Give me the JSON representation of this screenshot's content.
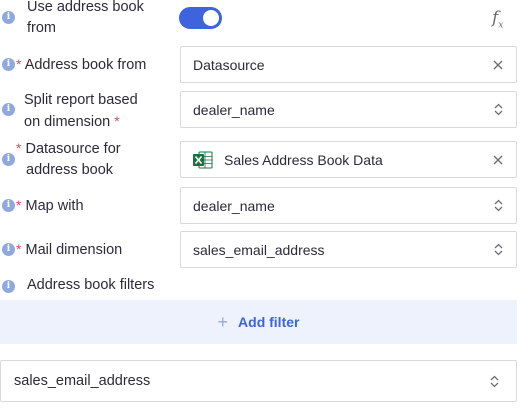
{
  "use_address_book": {
    "label_line1": "Use address book",
    "label_line2": "from",
    "enabled": true,
    "formula_icon": "fx-icon"
  },
  "address_book_from": {
    "label": "Address book from",
    "required_mark": "*",
    "value": "Datasource"
  },
  "split_report": {
    "label_line1": "Split report based",
    "label_line2": "on dimension",
    "required_mark": "*",
    "value": "dealer_name"
  },
  "datasource_for": {
    "label_line1": "Datasource for",
    "label_line2": "address book",
    "required_mark": "*",
    "value": "Sales Address Book Data",
    "icon": "excel-icon"
  },
  "map_with": {
    "label": "Map with",
    "required_mark": "*",
    "value": "dealer_name"
  },
  "mail_dimension": {
    "label": "Mail dimension",
    "required_mark": "*",
    "value": "sales_email_address"
  },
  "address_book_filters": {
    "label": "Address book filters",
    "add_filter_label": "Add filter"
  },
  "bottom_select": {
    "value": "sales_email_address"
  },
  "colors": {
    "accent": "#3d63dd",
    "required": "#e0455b",
    "info": "#8fa9df",
    "filter_bg": "#eef2fc",
    "excel_green": "#1d7044"
  }
}
